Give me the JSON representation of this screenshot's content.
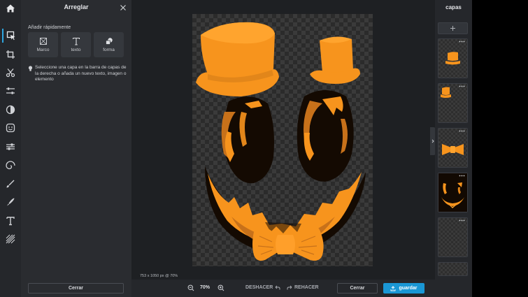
{
  "panel": {
    "title": "Arreglar",
    "quick_add_label": "Añadir rápidamente",
    "quick_add": [
      {
        "label": "Marco",
        "icon": "frame-icon"
      },
      {
        "label": "texto",
        "icon": "text-icon"
      },
      {
        "label": "forma",
        "icon": "shapes-icon"
      }
    ],
    "hint": "Seleccione una capa en la barra de capas de la derecha o añada un nuevo texto, imagen o elemento",
    "cancel_label": "Cerrar"
  },
  "rail": [
    {
      "name": "home-icon"
    },
    {
      "name": "arrange-icon",
      "active": true
    },
    {
      "name": "crop-icon"
    },
    {
      "name": "cutout-icon"
    },
    {
      "name": "adjust-icon"
    },
    {
      "name": "effects-icon"
    },
    {
      "name": "stickers-icon"
    },
    {
      "name": "filters-icon"
    },
    {
      "name": "spiral-icon"
    },
    {
      "name": "brush-icon"
    },
    {
      "name": "draw-icon"
    },
    {
      "name": "text-tool-icon"
    },
    {
      "name": "texture-icon"
    }
  ],
  "canvas": {
    "dimensions": "753 x 1050 px @ 70%"
  },
  "layers": {
    "title": "capas",
    "items": [
      {
        "name": "layer-hat-large"
      },
      {
        "name": "layer-hat-small"
      },
      {
        "name": "layer-bowtie"
      },
      {
        "name": "layer-pumpkin-face"
      },
      {
        "name": "layer-background"
      }
    ]
  },
  "bottom": {
    "zoom": "70%",
    "undo_label": "DESHACER",
    "redo_label": "REHACER",
    "cancel_label": "Cerrar",
    "save_label": "guardar"
  },
  "colors": {
    "accent": "#1a97d5",
    "orange": "#f7941d",
    "face_dark": "#140a02"
  }
}
